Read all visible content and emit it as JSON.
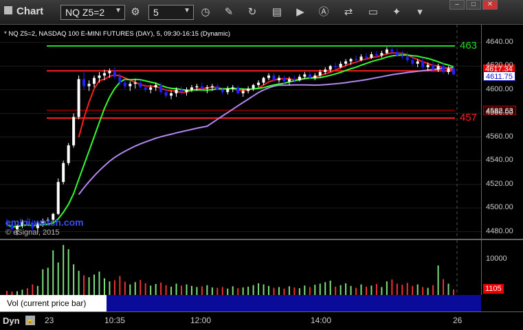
{
  "toolbar": {
    "app_title": "Chart",
    "symbol": "NQ Z5=2",
    "interval": "5",
    "window_controls": [
      "–",
      "□",
      "✕"
    ]
  },
  "chart_header": "* NQ Z5=2, NASDAQ 100 E-MINI FUTURES (DAY), 5, 09:30-16:15 (Dynamic)",
  "watermark": "emini-watch.com",
  "copyright": "© eSignal, 2015",
  "price_axis": {
    "ticks": [
      "4640.00",
      "4620.00",
      "4600.00",
      "4580.00",
      "4560.00",
      "4540.00",
      "4520.00",
      "4500.00",
      "4480.00"
    ]
  },
  "price_tags": {
    "red_top": "4617.34",
    "blue_last": "4611.75",
    "dark_mid": "4582.63",
    "green_line_label": "463",
    "red_line_label": "457"
  },
  "volume": {
    "axis_tick": "10000",
    "last_tag": "1105",
    "label": "Vol (current price bar)",
    "close": "×"
  },
  "time_axis": {
    "dyn": "Dyn",
    "labels": [
      "23",
      "10:35",
      "12:00",
      "14:00",
      "26"
    ]
  },
  "colors": {
    "up": "#ffffff",
    "down": "#2222ff",
    "green_ma": "#33ff33",
    "red_ma": "#ff2020",
    "purple_ma": "#b488f0",
    "support": "#ff2020",
    "resistance": "#22dd22",
    "vol_up": "#7ee07e",
    "vol_down": "#ee3333"
  },
  "chart_data": {
    "type": "candlestick",
    "ylim": [
      4474,
      4655
    ],
    "vol_ylim": [
      0,
      14500
    ],
    "horizontal_lines": [
      {
        "name": "green",
        "value": 4637
      },
      {
        "name": "red",
        "value": 4616
      },
      {
        "name": "darkred",
        "value": 4582.6
      },
      {
        "name": "red2",
        "value": 4576
      }
    ],
    "candles": [
      [
        4488,
        4491,
        4484,
        4486
      ],
      [
        4486,
        4489,
        4480,
        4482
      ],
      [
        4482,
        4486,
        4477,
        4485
      ],
      [
        4485,
        4490,
        4483,
        4488
      ],
      [
        4488,
        4492,
        4485,
        4487
      ],
      [
        4487,
        4490,
        4480,
        4483
      ],
      [
        4483,
        4488,
        4479,
        4487
      ],
      [
        4487,
        4491,
        4484,
        4489
      ],
      [
        4489,
        4492,
        4486,
        4490
      ],
      [
        4490,
        4496,
        4488,
        4495
      ],
      [
        4495,
        4525,
        4494,
        4522
      ],
      [
        4522,
        4540,
        4520,
        4538
      ],
      [
        4538,
        4555,
        4536,
        4553
      ],
      [
        4553,
        4580,
        4551,
        4577
      ],
      [
        4577,
        4612,
        4575,
        4609
      ],
      [
        4609,
        4616,
        4600,
        4603
      ],
      [
        4603,
        4608,
        4599,
        4605
      ],
      [
        4605,
        4612,
        4602,
        4610
      ],
      [
        4610,
        4615,
        4606,
        4612
      ],
      [
        4612,
        4617,
        4608,
        4614
      ],
      [
        4614,
        4618,
        4610,
        4616
      ],
      [
        4616,
        4619,
        4609,
        4611
      ],
      [
        4611,
        4614,
        4604,
        4606
      ],
      [
        4606,
        4609,
        4601,
        4603
      ],
      [
        4603,
        4607,
        4599,
        4605
      ],
      [
        4605,
        4609,
        4601,
        4606
      ],
      [
        4606,
        4608,
        4601,
        4602
      ],
      [
        4602,
        4605,
        4598,
        4600
      ],
      [
        4600,
        4604,
        4597,
        4602
      ],
      [
        4602,
        4606,
        4599,
        4604
      ],
      [
        4604,
        4606,
        4596,
        4598
      ],
      [
        4598,
        4601,
        4593,
        4595
      ],
      [
        4595,
        4599,
        4592,
        4597
      ],
      [
        4597,
        4602,
        4594,
        4600
      ],
      [
        4600,
        4603,
        4596,
        4598
      ],
      [
        4598,
        4602,
        4595,
        4600
      ],
      [
        4600,
        4604,
        4598,
        4602
      ],
      [
        4602,
        4605,
        4599,
        4603
      ],
      [
        4603,
        4606,
        4600,
        4601
      ],
      [
        4601,
        4604,
        4597,
        4602
      ],
      [
        4602,
        4605,
        4599,
        4603
      ],
      [
        4603,
        4605,
        4599,
        4600
      ],
      [
        4600,
        4602,
        4596,
        4598
      ],
      [
        4598,
        4603,
        4596,
        4601
      ],
      [
        4601,
        4604,
        4598,
        4602
      ],
      [
        4602,
        4604,
        4596,
        4597
      ],
      [
        4597,
        4601,
        4594,
        4599
      ],
      [
        4599,
        4603,
        4597,
        4601
      ],
      [
        4601,
        4605,
        4599,
        4604
      ],
      [
        4604,
        4608,
        4602,
        4606
      ],
      [
        4606,
        4611,
        4604,
        4610
      ],
      [
        4610,
        4614,
        4608,
        4612
      ],
      [
        4612,
        4614,
        4607,
        4608
      ],
      [
        4608,
        4612,
        4606,
        4610
      ],
      [
        4610,
        4612,
        4605,
        4607
      ],
      [
        4607,
        4611,
        4604,
        4609
      ],
      [
        4609,
        4612,
        4606,
        4608
      ],
      [
        4608,
        4613,
        4607,
        4611
      ],
      [
        4611,
        4615,
        4609,
        4613
      ],
      [
        4613,
        4615,
        4609,
        4610
      ],
      [
        4610,
        4614,
        4608,
        4612
      ],
      [
        4612,
        4617,
        4611,
        4615
      ],
      [
        4615,
        4619,
        4613,
        4617
      ],
      [
        4617,
        4621,
        4615,
        4620
      ],
      [
        4620,
        4623,
        4617,
        4619
      ],
      [
        4619,
        4624,
        4618,
        4622
      ],
      [
        4622,
        4626,
        4620,
        4624
      ],
      [
        4624,
        4627,
        4621,
        4626
      ],
      [
        4626,
        4629,
        4623,
        4625
      ],
      [
        4625,
        4630,
        4624,
        4628
      ],
      [
        4628,
        4631,
        4625,
        4627
      ],
      [
        4627,
        4632,
        4626,
        4630
      ],
      [
        4630,
        4633,
        4627,
        4629
      ],
      [
        4629,
        4633,
        4627,
        4631
      ],
      [
        4631,
        4636,
        4630,
        4634
      ],
      [
        4634,
        4637,
        4630,
        4632
      ],
      [
        4632,
        4635,
        4628,
        4629
      ],
      [
        4629,
        4633,
        4626,
        4628
      ],
      [
        4628,
        4632,
        4623,
        4625
      ],
      [
        4625,
        4628,
        4620,
        4622
      ],
      [
        4622,
        4626,
        4619,
        4624
      ],
      [
        4624,
        4627,
        4617,
        4619
      ],
      [
        4619,
        4623,
        4616,
        4621
      ],
      [
        4621,
        4624,
        4615,
        4617
      ],
      [
        4617,
        4622,
        4615,
        4620
      ],
      [
        4620,
        4624,
        4613,
        4615
      ],
      [
        4615,
        4620,
        4613,
        4618
      ],
      [
        4618,
        4621,
        4612,
        4613
      ]
    ],
    "volume": [
      1100,
      900,
      1000,
      1400,
      1800,
      2800,
      2400,
      6800,
      7200,
      11800,
      8600,
      13200,
      12100,
      8100,
      6400,
      5200,
      4700,
      5400,
      6200,
      4400,
      3600,
      3900,
      5000,
      3500,
      2800,
      3400,
      4000,
      3100,
      2500,
      2900,
      3300,
      2600,
      2200,
      3000,
      2500,
      2800,
      2400,
      2100,
      2300,
      2600,
      2000,
      1900,
      2100,
      1700,
      2300,
      1800,
      2000,
      2200,
      2600,
      3100,
      2800,
      2400,
      1900,
      2100,
      1700,
      2300,
      2000,
      1800,
      2500,
      2100,
      2700,
      3000,
      3400,
      3800,
      2200,
      2600,
      3100,
      2400,
      1900,
      2800,
      2200,
      2500,
      2900,
      2100,
      3600,
      4100,
      3000,
      2700,
      3200,
      2400,
      2800,
      2100,
      1900,
      2600,
      7800,
      4200,
      3000,
      1500
    ]
  }
}
